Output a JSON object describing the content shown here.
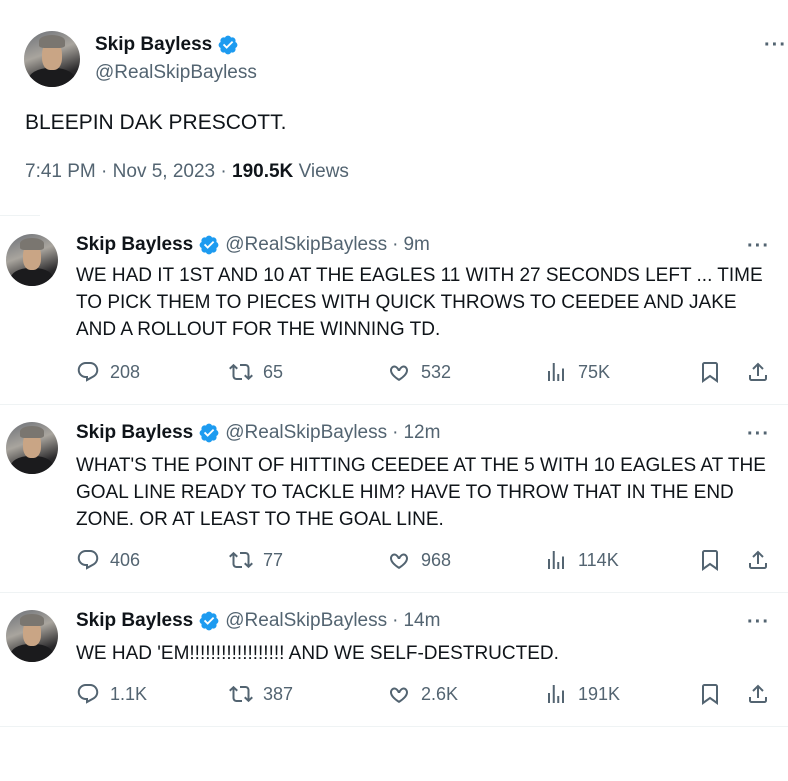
{
  "main_tweet": {
    "display_name": "Skip Bayless",
    "handle": "@RealSkipBayless",
    "text": "BLEEPIN DAK PRESCOTT.",
    "time": "7:41 PM",
    "date": "Nov 5, 2023",
    "views_count": "190.5K",
    "views_label": "Views",
    "dot": "·",
    "more": "···"
  },
  "replies": [
    {
      "display_name": "Skip Bayless",
      "handle": "@RealSkipBayless",
      "time": "9m",
      "text": "WE HAD IT 1ST AND 10 AT THE EAGLES 11 WITH 27 SECONDS LEFT ... TIME TO PICK THEM TO PIECES WITH QUICK THROWS TO CEEDEE AND JAKE AND A ROLLOUT FOR THE WINNING TD.",
      "replies": "208",
      "reposts": "65",
      "likes": "532",
      "views": "75K"
    },
    {
      "display_name": "Skip Bayless",
      "handle": "@RealSkipBayless",
      "time": "12m",
      "text": "WHAT'S THE POINT OF HITTING CEEDEE AT THE 5 WITH 10 EAGLES AT THE GOAL LINE READY TO TACKLE HIM? HAVE TO THROW THAT IN THE END ZONE. OR AT LEAST TO THE GOAL LINE.",
      "replies": "406",
      "reposts": "77",
      "likes": "968",
      "views": "114K"
    },
    {
      "display_name": "Skip Bayless",
      "handle": "@RealSkipBayless",
      "time": "14m",
      "text": "WE HAD 'EM!!!!!!!!!!!!!!!!!! AND WE SELF-DESTRUCTED.",
      "replies": "1.1K",
      "reposts": "387",
      "likes": "2.6K",
      "views": "191K"
    }
  ],
  "icons": {
    "verified": "verified-badge-icon",
    "reply": "reply-icon",
    "repost": "repost-icon",
    "like": "heart-icon",
    "views": "views-chart-icon",
    "bookmark": "bookmark-icon",
    "share": "share-icon",
    "more": "more-icon"
  },
  "colors": {
    "verified": "#1d9bf0",
    "secondary_text": "#536471",
    "primary_text": "#0f1419",
    "divider": "#eff3f4"
  }
}
